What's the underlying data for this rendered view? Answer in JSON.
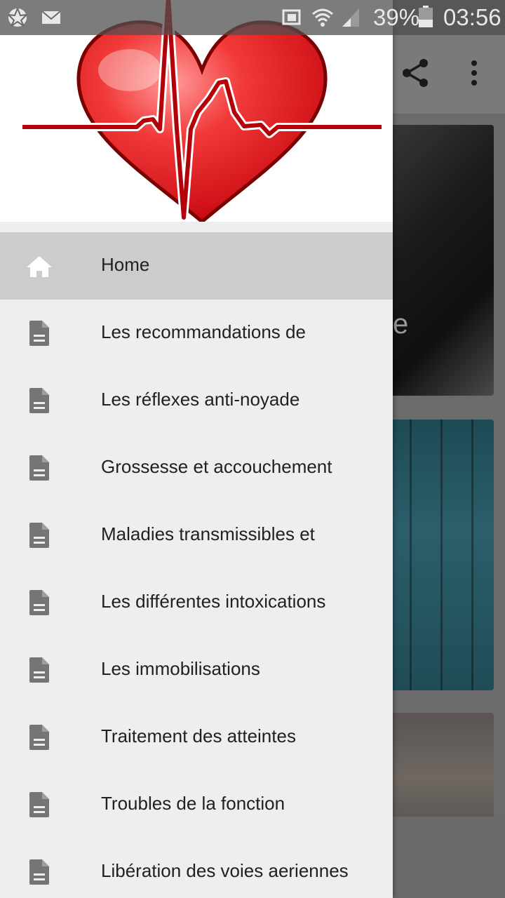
{
  "status_bar": {
    "battery_percent": "39%",
    "time": "03:56",
    "icons": [
      "aperture-icon",
      "mail-icon",
      "cast-icon",
      "wifi-icon",
      "signal-icon",
      "battery-icon"
    ]
  },
  "toolbar": {
    "icons": [
      "share-icon",
      "more-vert-icon"
    ]
  },
  "background": {
    "card_1_partial_text": "e"
  },
  "drawer": {
    "header_image": "heart-ecg-logo",
    "items": [
      {
        "label": "Home",
        "icon": "home-icon",
        "active": true
      },
      {
        "label": "Les recommandations de",
        "icon": "document-icon"
      },
      {
        "label": "Les réflexes anti-noyade",
        "icon": "document-icon"
      },
      {
        "label": "Grossesse et accouchement",
        "icon": "document-icon"
      },
      {
        "label": "Maladies transmissibles et",
        "icon": "document-icon"
      },
      {
        "label": "Les différentes intoxications",
        "icon": "document-icon"
      },
      {
        "label": "Les immobilisations",
        "icon": "document-icon"
      },
      {
        "label": "Traitement des atteintes",
        "icon": "document-icon"
      },
      {
        "label": "Troubles de la fonction",
        "icon": "document-icon"
      },
      {
        "label": "Libération des voies aeriennes",
        "icon": "document-icon"
      }
    ]
  },
  "colors": {
    "drawer_bg": "#eeeeee",
    "active_item_bg": "#cccccc",
    "icon_gray": "#757575",
    "heart_red": "#e8101a"
  }
}
